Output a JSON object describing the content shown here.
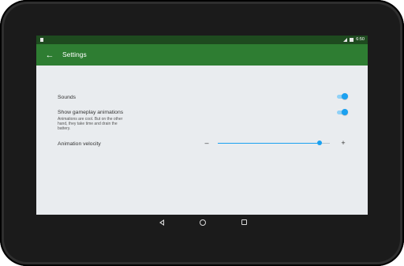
{
  "status_bar": {
    "time": "6:50",
    "icons": [
      "notification-icon",
      "signal-icon",
      "battery-icon"
    ]
  },
  "app_bar": {
    "back_icon": "arrow-back-icon",
    "title": "Settings",
    "color": "#2e7d32"
  },
  "preferences": {
    "sounds": {
      "title": "Sounds",
      "enabled": true
    },
    "gameplay_animations": {
      "title": "Show gameplay animations",
      "summary": "Animations are cool. But on the other hand, they take time and drain the battery.",
      "enabled": true
    },
    "animation_velocity": {
      "title": "Animation velocity",
      "minus_label": "–",
      "plus_label": "+",
      "value_fraction": 0.91
    }
  },
  "accent_color": "#1aa1f1",
  "nav_bar": {
    "icons": [
      "back-triangle-icon",
      "home-circle-icon",
      "recents-square-icon"
    ]
  }
}
